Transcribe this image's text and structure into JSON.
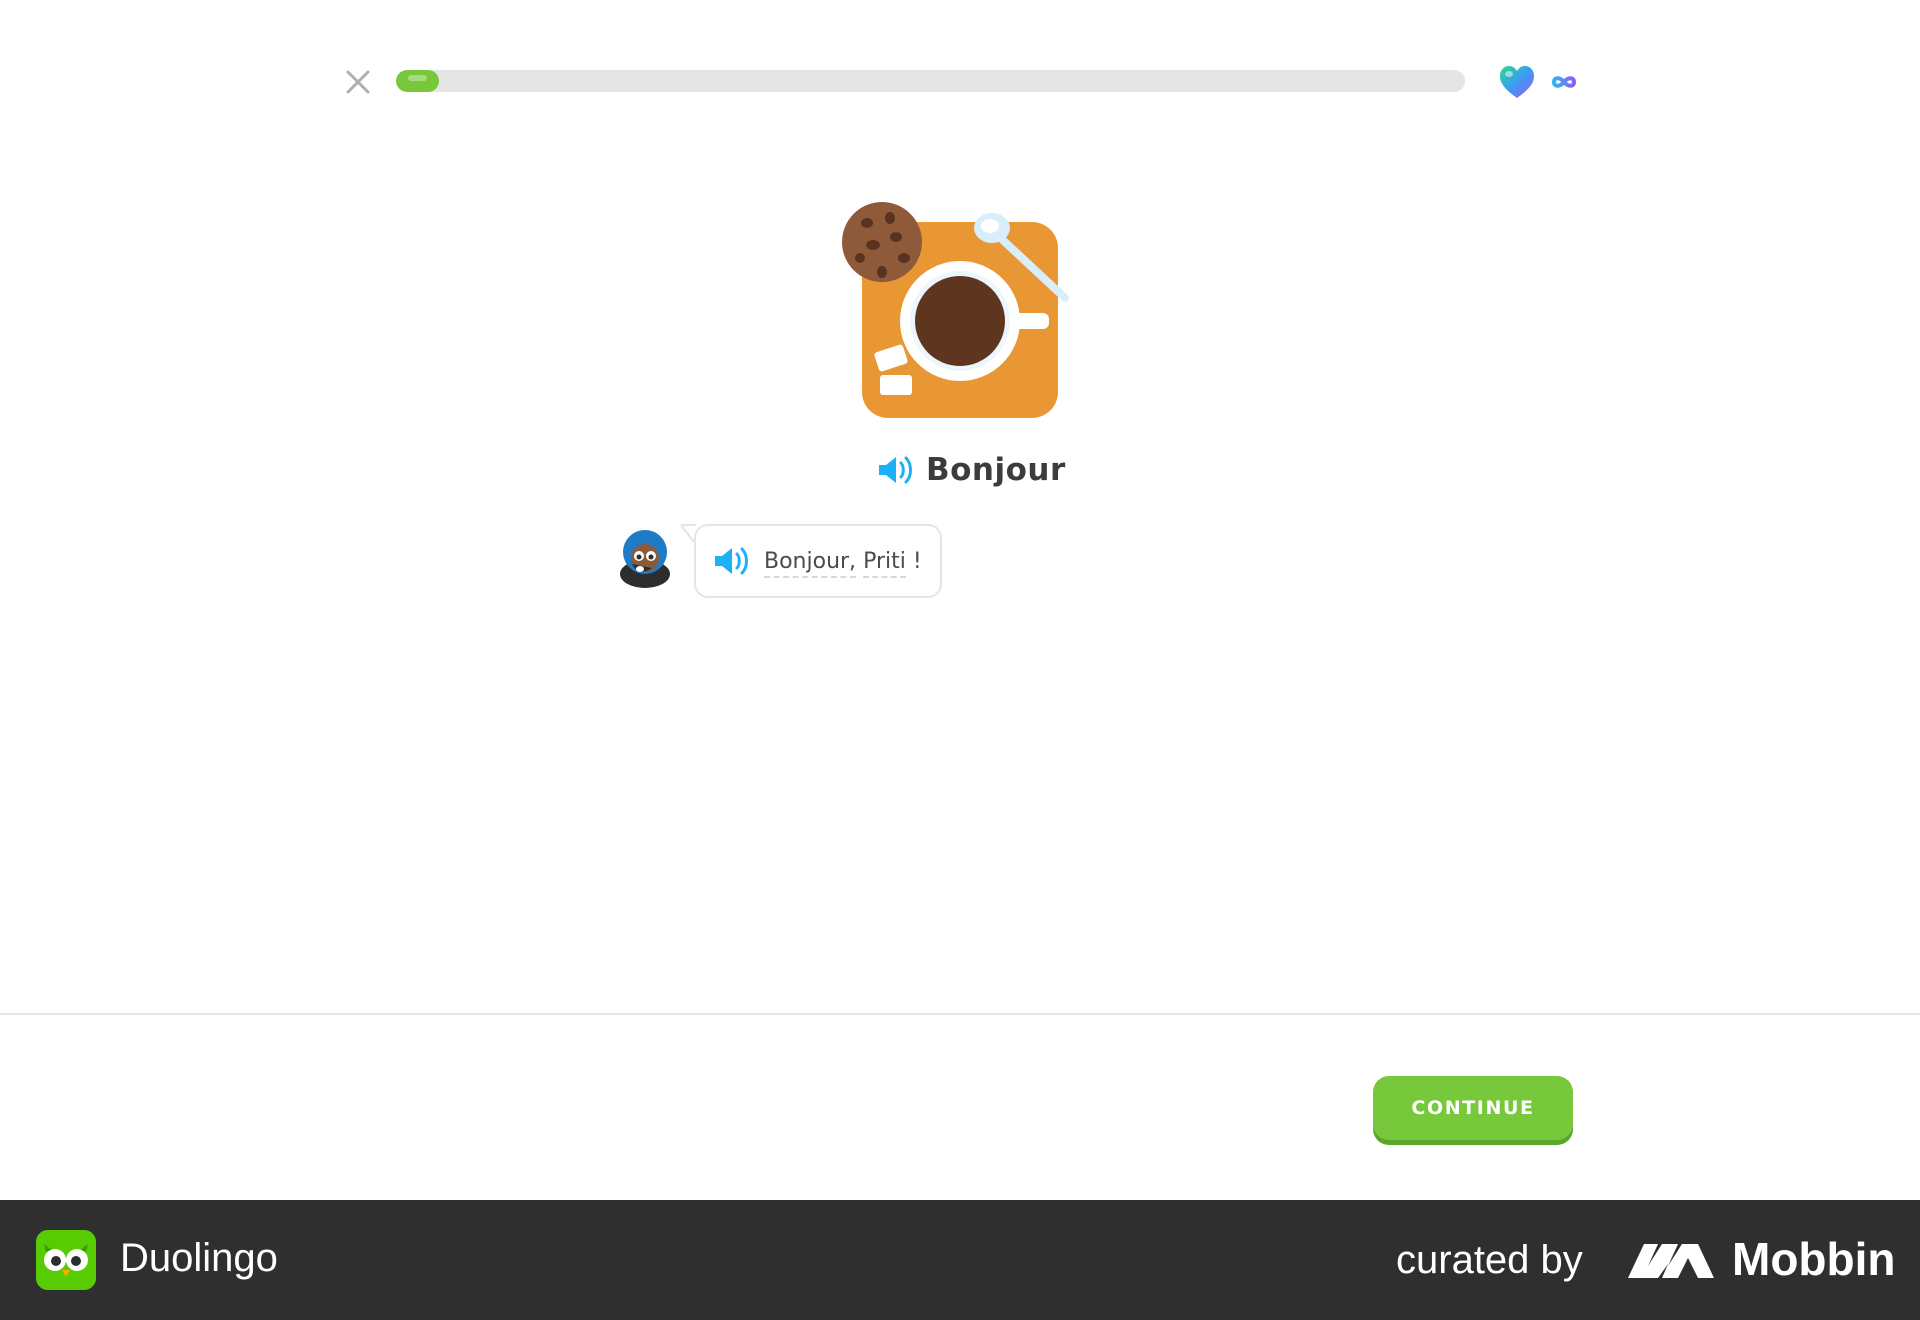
{
  "header": {
    "close_icon": "close-icon",
    "progress_fraction": 0.04,
    "progress_color": "#78c83c",
    "hearts_icon": "gradient-heart-icon",
    "hearts_value_icon": "infinity-icon"
  },
  "lesson": {
    "illustration": "coffee-cookie-illustration",
    "word": "Bonjour",
    "speaker_icon": "speaker-icon"
  },
  "dialog": {
    "avatar": "character-avatar",
    "tokens": [
      "Bonjour,",
      "Priti",
      "!"
    ]
  },
  "footer": {
    "continue_label": "CONTINUE",
    "continue_color": "#78c83c"
  },
  "banner": {
    "app_name": "Duolingo",
    "curated_label": "curated by",
    "brand": "Mobbin"
  }
}
